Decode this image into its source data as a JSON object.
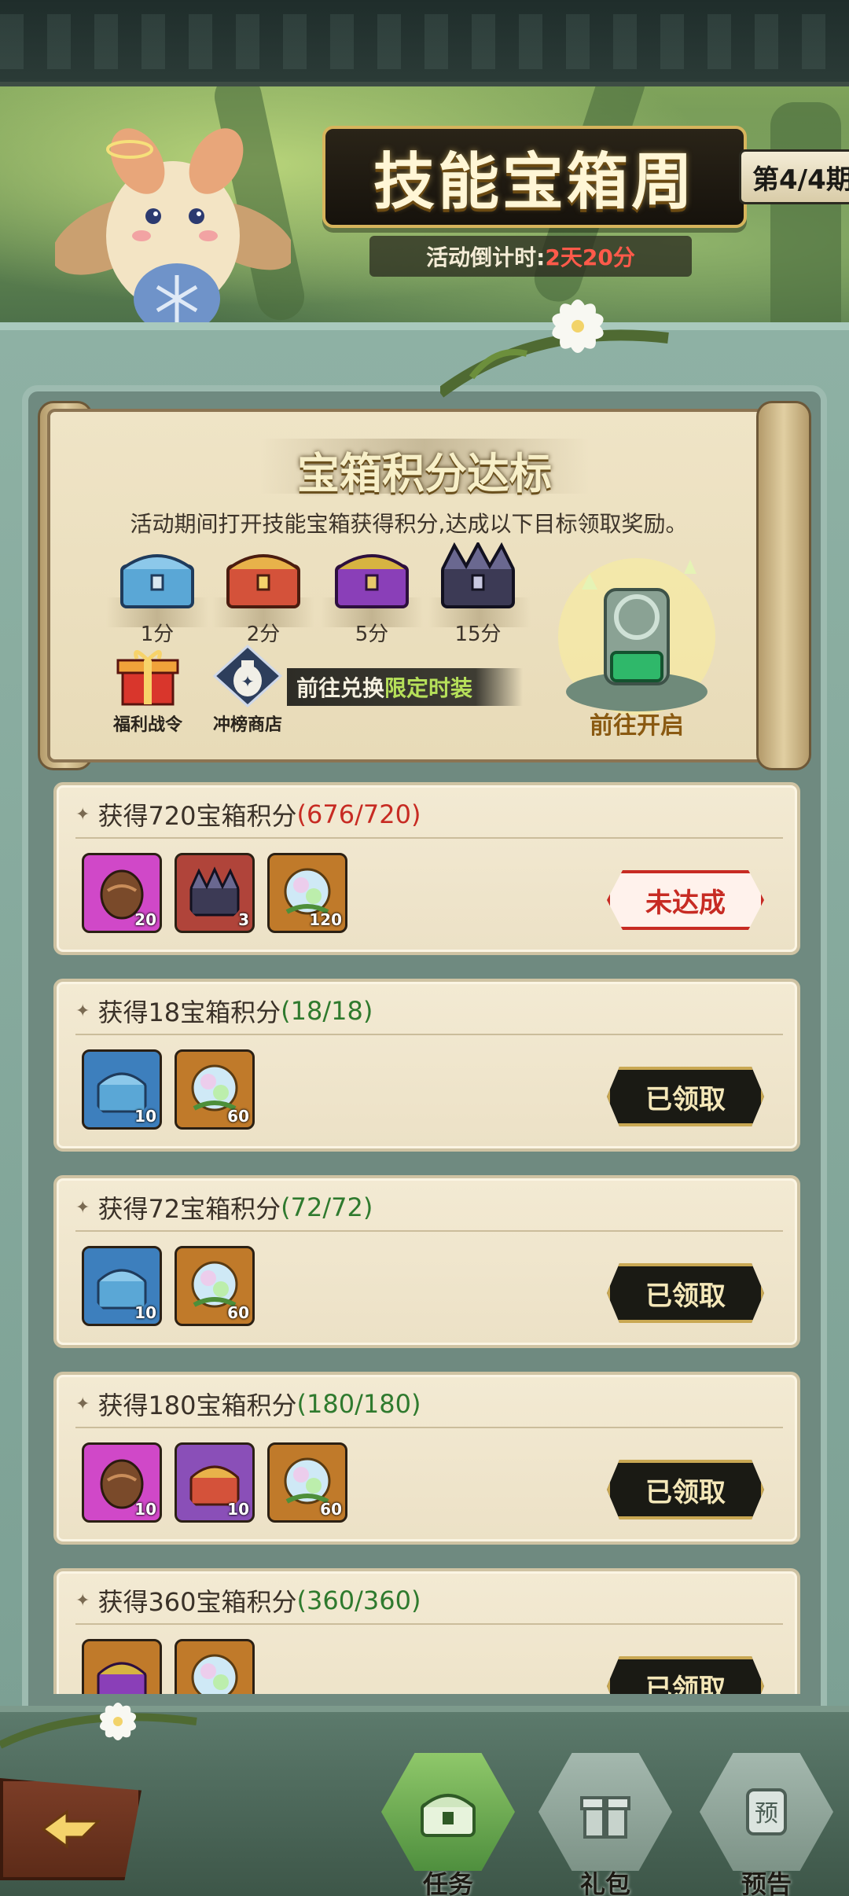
{
  "header": {
    "title": "技能宝箱周",
    "period": "第4/4期",
    "countdown_label": "活动倒计时:",
    "countdown_value": "2天20分"
  },
  "panel": {
    "title": "宝箱积分达标",
    "description": "活动期间打开技能宝箱获得积分,达成以下目标领取奖励。",
    "chests": [
      {
        "icon": "blue-chest-icon",
        "points": "1分"
      },
      {
        "icon": "red-chest-icon",
        "points": "2分"
      },
      {
        "icon": "purple-chest-icon",
        "points": "5分"
      },
      {
        "icon": "dark-chest-icon",
        "points": "15分"
      }
    ],
    "welfare_label": "福利战令",
    "shop_label": "冲榜商店",
    "exchange_prefix": "前往兑换",
    "exchange_highlight": "限定时装",
    "open_label": "前往开启"
  },
  "tasks": [
    {
      "title": "获得720宝箱积分",
      "progress": "(676/720)",
      "done": false,
      "status": "未达成",
      "rewards": [
        {
          "icon": "egg-icon",
          "count": "20",
          "color": "#d048c8"
        },
        {
          "icon": "dark-chest-icon",
          "count": "3",
          "color": "#b0443a"
        },
        {
          "icon": "crystal-orb-icon",
          "count": "120",
          "color": "#c07a2a"
        }
      ]
    },
    {
      "title": "获得18宝箱积分",
      "progress": "(18/18)",
      "done": true,
      "status": "已领取",
      "rewards": [
        {
          "icon": "blue-chest-icon",
          "count": "10",
          "color": "#3d7fbd"
        },
        {
          "icon": "crystal-orb-icon",
          "count": "60",
          "color": "#c07a2a"
        }
      ]
    },
    {
      "title": "获得72宝箱积分",
      "progress": "(72/72)",
      "done": true,
      "status": "已领取",
      "rewards": [
        {
          "icon": "blue-chest-icon",
          "count": "10",
          "color": "#3d7fbd"
        },
        {
          "icon": "crystal-orb-icon",
          "count": "60",
          "color": "#c07a2a"
        }
      ]
    },
    {
      "title": "获得180宝箱积分",
      "progress": "(180/180)",
      "done": true,
      "status": "已领取",
      "rewards": [
        {
          "icon": "egg-icon",
          "count": "10",
          "color": "#d048c8"
        },
        {
          "icon": "red-chest-icon",
          "count": "10",
          "color": "#8a4fb8"
        },
        {
          "icon": "crystal-orb-icon",
          "count": "60",
          "color": "#c07a2a"
        }
      ]
    },
    {
      "title": "获得360宝箱积分",
      "progress": "(360/360)",
      "done": true,
      "status": "已领取",
      "rewards": [
        {
          "icon": "purple-chest-icon",
          "count": "",
          "color": "#c07a2a"
        },
        {
          "icon": "crystal-orb-icon",
          "count": "",
          "color": "#c07a2a"
        }
      ]
    }
  ],
  "nav": {
    "tasks": "任务",
    "gifts": "礼包",
    "preview": "预告",
    "preview_glyph": "预"
  },
  "colors": {
    "progress_incomplete": "#c72b23",
    "progress_complete": "#2f7a2e",
    "nav_active": "#6fae52"
  }
}
